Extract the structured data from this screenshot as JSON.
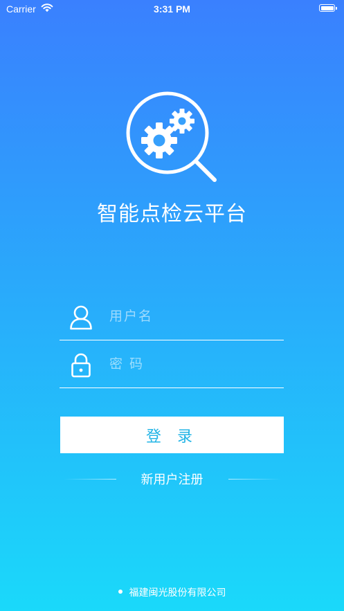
{
  "status_bar": {
    "carrier": "Carrier",
    "time": "3:31 PM",
    "icons": [
      "wifi-icon",
      "battery-icon"
    ]
  },
  "app": {
    "title": "智能点检云平台",
    "logo_icon": "gear-magnifier-icon"
  },
  "form": {
    "username": {
      "placeholder": "用户名",
      "value": "",
      "icon": "user-icon"
    },
    "password": {
      "placeholder": "密 码",
      "value": "",
      "icon": "lock-icon"
    },
    "login_label": "登 录",
    "register_label": "新用户注册"
  },
  "footer": {
    "company": "福建闽光股份有限公司"
  },
  "colors": {
    "gradient_top": "#3a80fe",
    "gradient_bottom": "#1ad9fa",
    "button_text": "#21b4e6",
    "foreground": "#ffffff"
  }
}
